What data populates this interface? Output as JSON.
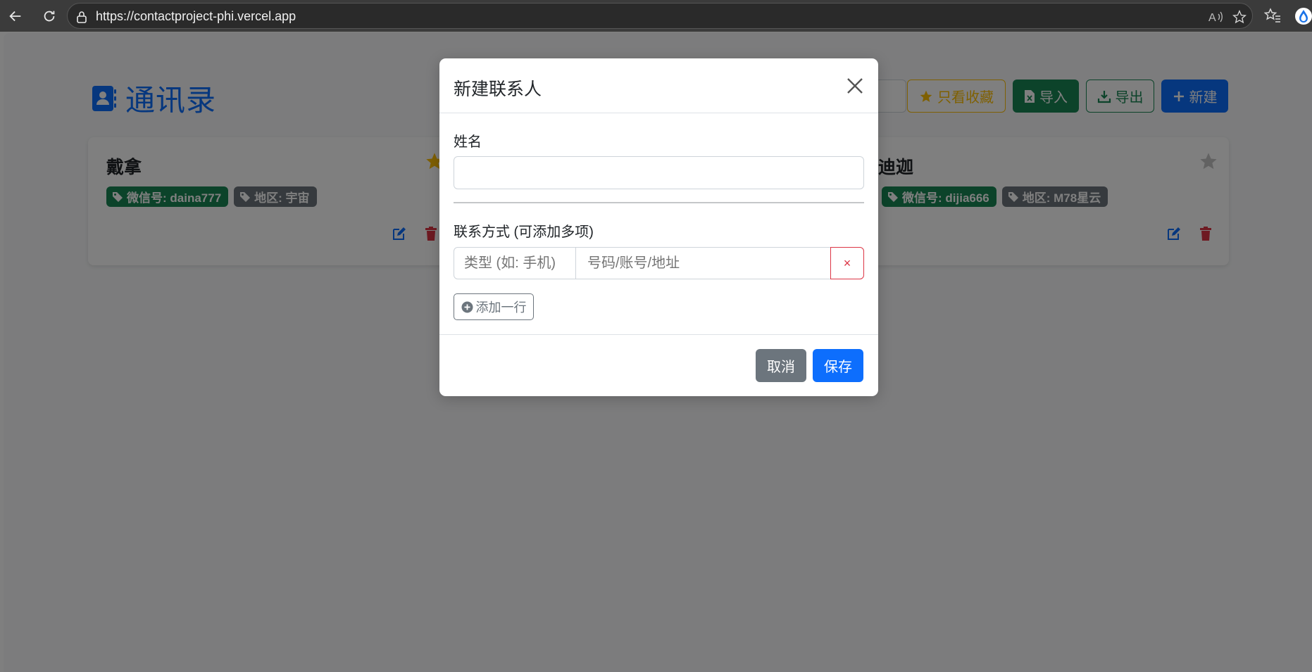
{
  "browser": {
    "url": "https://contactproject-phi.vercel.app"
  },
  "app": {
    "title": "通讯录",
    "toolbar": {
      "favorites_label": "只看收藏",
      "import_label": "导入",
      "export_label": "导出",
      "new_label": "新建"
    }
  },
  "contacts": [
    {
      "name": "戴拿",
      "favorite": true,
      "tags": [
        "微信号: daina777",
        "地区: 宇宙"
      ]
    },
    {
      "name": "迪迦",
      "favorite": false,
      "tags": [
        "微信号: dijia666",
        "地区: M78星云"
      ]
    }
  ],
  "modal": {
    "title": "新建联系人",
    "name_label": "姓名",
    "name_value": "",
    "contacts_label": "联系方式 (可添加多项)",
    "type_placeholder": "类型 (如: 手机)",
    "value_placeholder": "号码/账号/地址",
    "remove_glyph": "×",
    "add_row_label": "添加一行",
    "cancel_label": "取消",
    "save_label": "保存"
  },
  "colors": {
    "primary": "#0d6efd",
    "success": "#198754",
    "warning": "#ffc107",
    "secondary": "#6c757d",
    "danger": "#dc3545"
  }
}
